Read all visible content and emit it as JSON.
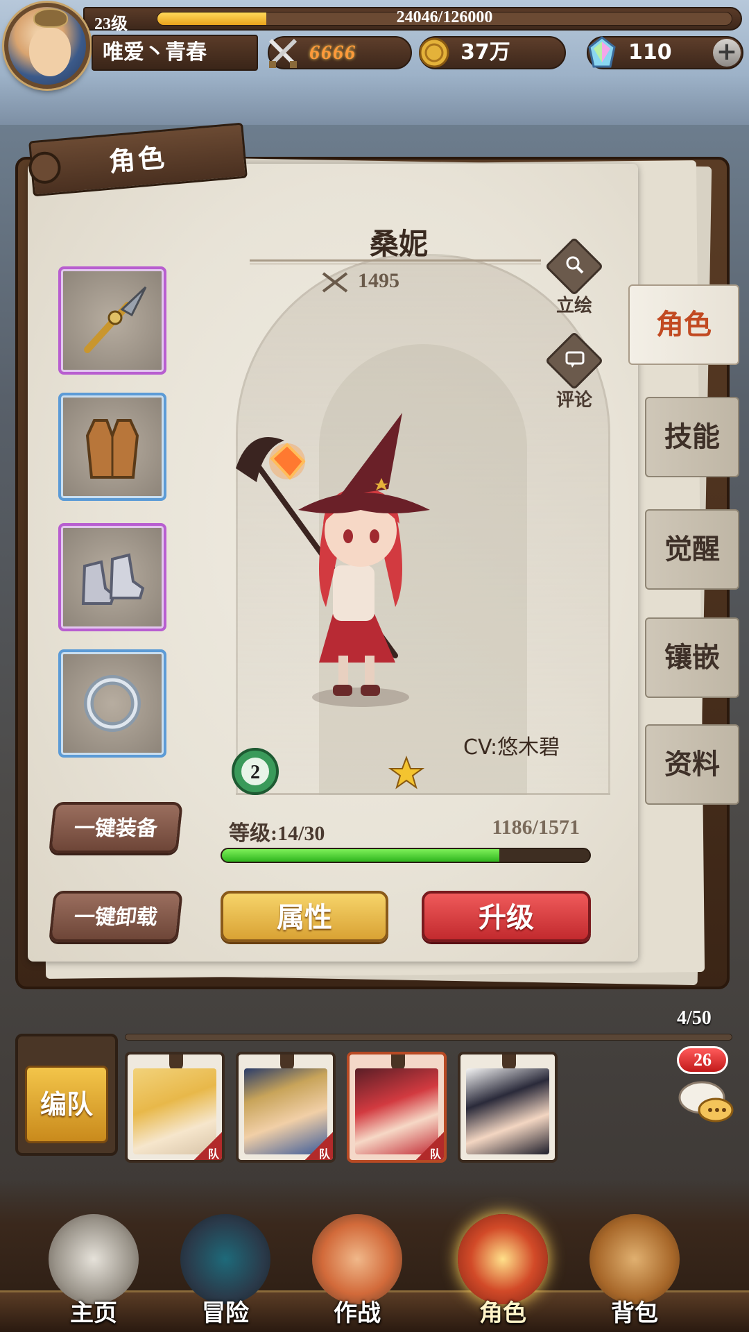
{
  "header": {
    "player_level": "23级",
    "xp": "24046/126000",
    "xp_fraction": 0.19,
    "player_name": "唯爱丶青春",
    "combat_power": "6666",
    "gold": "37万",
    "gems": "110",
    "plus": "+"
  },
  "panel": {
    "tab_title": "角色",
    "hero_name": "桑妮",
    "hero_power": "1495",
    "art_label": "立绘",
    "comment_label": "评论",
    "cv": "CV:悠木碧",
    "rank": "2",
    "stars": 1,
    "level_label": "等级:14/30",
    "exp_label": "1186/1571",
    "exp_fraction": 0.755,
    "equip_all": "一键装备",
    "unequip_all": "一键卸载",
    "attributes": "属性",
    "upgrade": "升级"
  },
  "equipment": [
    {
      "name": "spear-icon",
      "rarity": "purple"
    },
    {
      "name": "vest-icon",
      "rarity": "blue"
    },
    {
      "name": "boots-icon",
      "rarity": "purple"
    },
    {
      "name": "ring-icon",
      "rarity": "blue"
    }
  ],
  "side_tabs": [
    "角色",
    "技能",
    "觉醒",
    "镶嵌",
    "资料"
  ],
  "team": {
    "formation": "编队",
    "count": "4/50",
    "tag": "队",
    "chat_count": "26"
  },
  "nav": [
    "主页",
    "冒险",
    "作战",
    "角色",
    "背包"
  ],
  "colors": {
    "accent_red": "#c24a22",
    "exp_green": "#2fb51e",
    "xp_gold": "#e9a21c"
  }
}
